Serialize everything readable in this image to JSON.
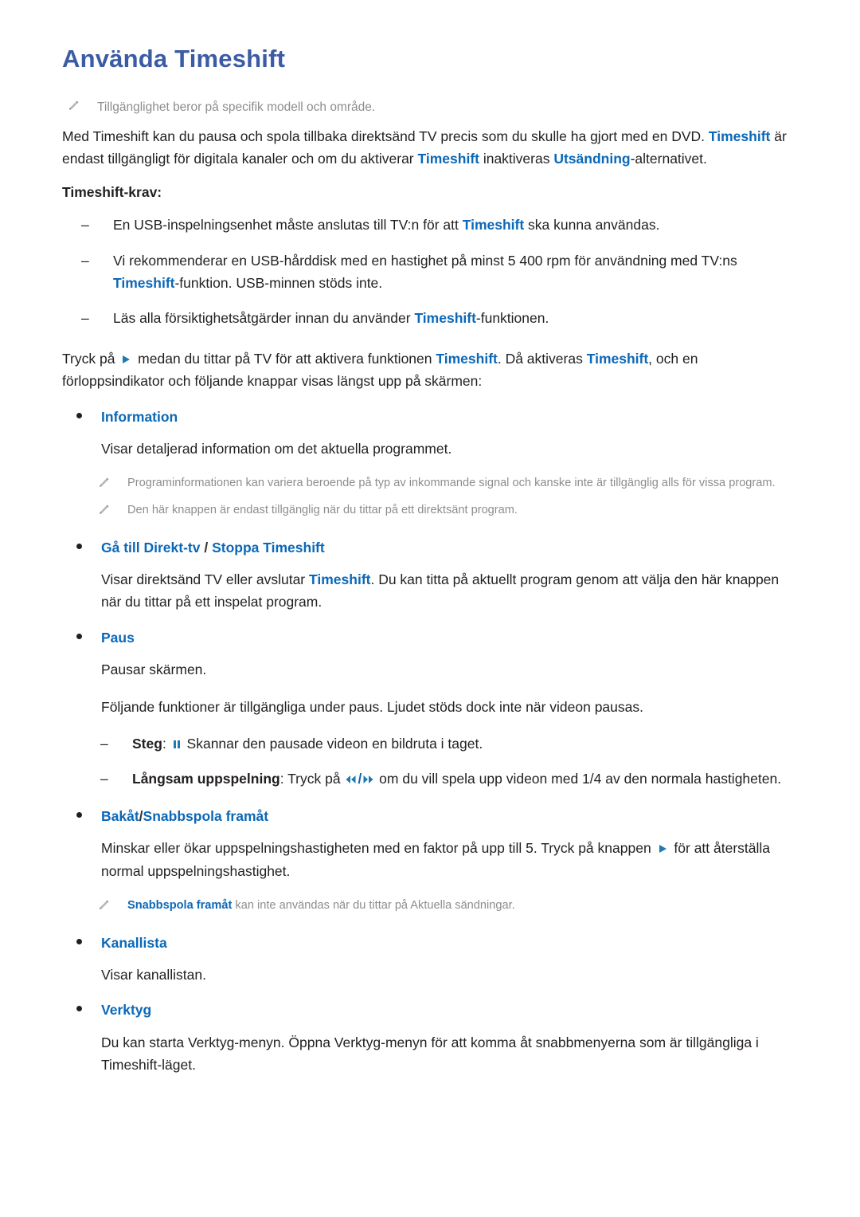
{
  "page": {
    "title": "Använda Timeshift",
    "colors": {
      "title_blue": "#3b5ba5",
      "accent_blue": "#0b68b8",
      "icon_teal": "#1f7ab0",
      "note_gray": "#8d8d8d",
      "body_black": "#231f20"
    }
  },
  "top_note": {
    "icon": "pencil-icon",
    "text": "Tillgänglighet beror på specifik modell och område."
  },
  "intro": {
    "p1_a": "Med Timeshift kan du pausa och spola tillbaka direktsänd TV precis som du skulle ha gjort med en DVD. ",
    "p1_hl1": "Timeshift",
    "p1_b": " är endast tillgängligt för digitala kanaler och om du aktiverar ",
    "p1_hl2": "Timeshift",
    "p1_c": " inaktiveras ",
    "p1_hl3": "Utsändning",
    "p1_d": "-alternativet."
  },
  "requirements": {
    "label": "Timeshift-krav:",
    "items": [
      {
        "dash": "–",
        "a": "En USB-inspelningsenhet måste anslutas till TV:n för att ",
        "hl": "Timeshift",
        "b": " ska kunna användas."
      },
      {
        "dash": "–",
        "a": "Vi rekommenderar en USB-hårddisk med en hastighet på minst 5 400 rpm för användning med TV:ns ",
        "hl": "Timeshift",
        "b": "-funktion. USB-minnen stöds inte."
      },
      {
        "dash": "–",
        "a": "Läs alla försiktighetsåtgärder innan du använder ",
        "hl": "Timeshift",
        "b": "-funktionen."
      }
    ]
  },
  "activation": {
    "a": "Tryck på ",
    "icon": "play-icon",
    "b": " medan du tittar på TV för att aktivera funktionen ",
    "hl1": "Timeshift",
    "c": ". Då aktiveras ",
    "hl2": "Timeshift",
    "d": ", och en förloppsindikator och följande knappar visas längst upp på skärmen:"
  },
  "sections": [
    {
      "id": "information",
      "heading": "Information",
      "body": "Visar detaljerad information om det aktuella programmet.",
      "notes": [
        "Programinformationen kan variera beroende på typ av inkommande signal och kanske inte är tillgänglig alls för vissa program.",
        "Den här knappen är endast tillgänglig när du tittar på ett direktsänt program."
      ]
    },
    {
      "id": "go-live-stop-timeshift",
      "heading_a": "Gå till Direkt-tv",
      "heading_sep": " / ",
      "heading_b": "Stoppa Timeshift",
      "body_a": "Visar direktsänd TV eller avslutar ",
      "body_hl": "Timeshift",
      "body_b": ". Du kan titta på aktuellt program genom att välja den här knappen när du tittar på ett inspelat program."
    },
    {
      "id": "paus",
      "heading": "Paus",
      "body1": "Pausar skärmen.",
      "body2": "Följande funktioner är tillgängliga under paus. Ljudet stöds dock inte när videon pausas.",
      "sub_items": [
        {
          "dash": "–",
          "label": "Steg",
          "after_label": ": ",
          "icon": "pause-icon",
          "text": " Skannar den pausade videon en bildruta i taget."
        },
        {
          "dash": "–",
          "label": "Långsam uppspelning",
          "after_label": ": Tryck på ",
          "icon_rw": "rewind-icon",
          "icon_slash": "/",
          "icon_ff": "fast-forward-icon",
          "text": " om du vill spela upp videon med 1/4 av den normala hastigheten."
        }
      ]
    },
    {
      "id": "rewind-fastforward",
      "heading_a": "Bakåt",
      "heading_sep": "/",
      "heading_b": "Snabbspola framåt",
      "body_a": "Minskar eller ökar uppspelningshastigheten med en faktor på upp till 5. Tryck på knappen ",
      "body_icon": "play-icon",
      "body_b": " för att återställa normal uppspelningshastighet.",
      "note_hl": "Snabbspola framåt",
      "note_rest": " kan inte användas när du tittar på Aktuella sändningar."
    },
    {
      "id": "kanallista",
      "heading": "Kanallista",
      "body": "Visar kanallistan."
    },
    {
      "id": "verktyg",
      "heading": "Verktyg",
      "body": "Du kan starta Verktyg-menyn. Öppna Verktyg-menyn för att komma åt snabbmenyerna som är tillgängliga i Timeshift-läget."
    }
  ]
}
